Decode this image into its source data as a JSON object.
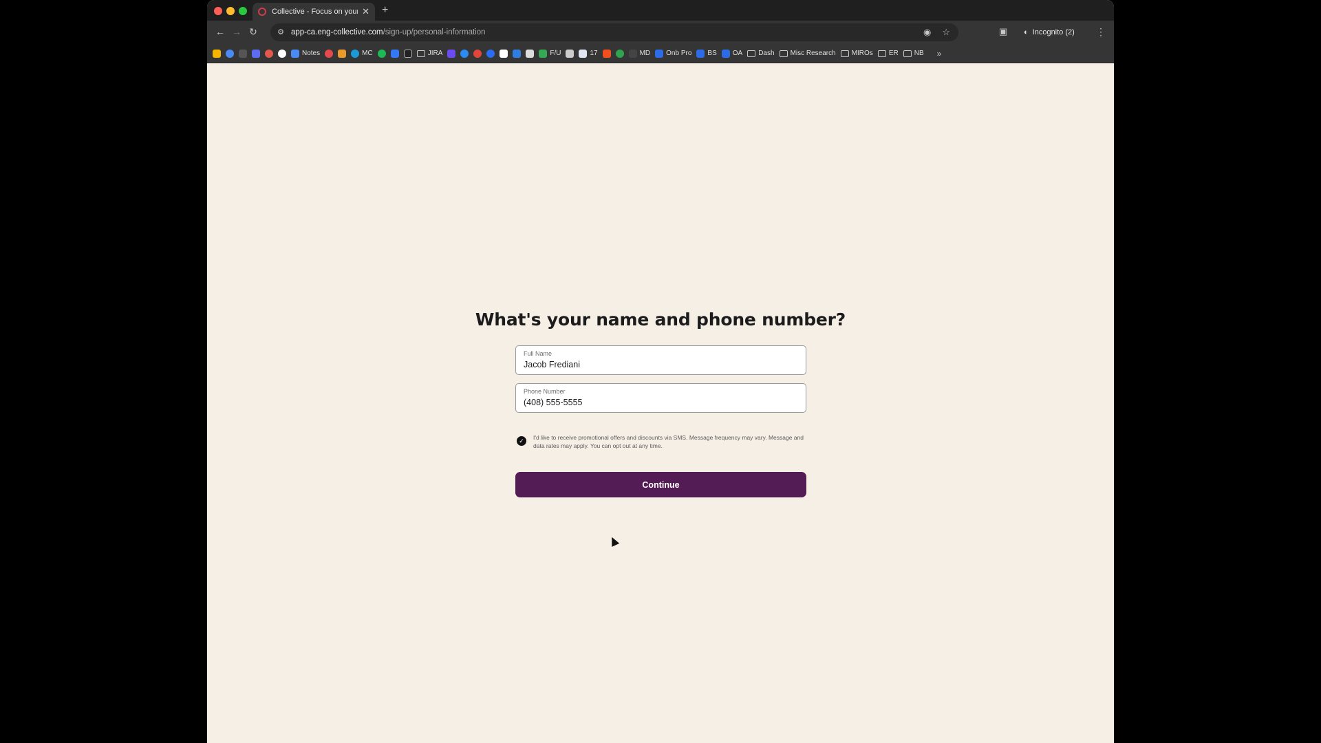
{
  "browser": {
    "tab_title": "Collective - Focus on your pa",
    "new_tab_glyph": "+",
    "url_domain": "app-ca.eng-collective.com",
    "url_path": "/sign-up/personal-information",
    "incognito_label": "Incognito (2)",
    "bookmarks": [
      {
        "label": "Notes",
        "icon": "docs-icon"
      },
      {
        "label": "MC",
        "icon": "cloud-icon"
      },
      {
        "label": "JIRA",
        "icon": "folder-icon"
      },
      {
        "label": "F/U",
        "icon": "drive-icon"
      },
      {
        "label": "17",
        "icon": "calendar-icon"
      },
      {
        "label": "MD",
        "icon": "doc-icon"
      },
      {
        "label": "Onb Pro",
        "icon": "x-icon"
      },
      {
        "label": "BS",
        "icon": "x-icon"
      },
      {
        "label": "OA",
        "icon": "x-icon"
      },
      {
        "label": "Dash",
        "icon": "folder-icon"
      },
      {
        "label": "Misc Research",
        "icon": "folder-icon"
      },
      {
        "label": "MIROs",
        "icon": "folder-icon"
      },
      {
        "label": "ER",
        "icon": "folder-icon"
      },
      {
        "label": "NB",
        "icon": "folder-icon"
      }
    ]
  },
  "form": {
    "heading": "What's your name and phone number?",
    "full_name": {
      "label": "Full Name",
      "value": "Jacob Frediani"
    },
    "phone": {
      "label": "Phone Number",
      "value": "(408) 555-5555"
    },
    "consent_text": "I'd like to receive promotional offers and discounts via SMS. Message frequency may vary. Message and data rates may apply. You can opt out at any time.",
    "consent_checked": true,
    "continue_label": "Continue"
  },
  "colors": {
    "page_background": "#f6efe6",
    "button_background": "#541c54",
    "browser_chrome": "#353535"
  }
}
